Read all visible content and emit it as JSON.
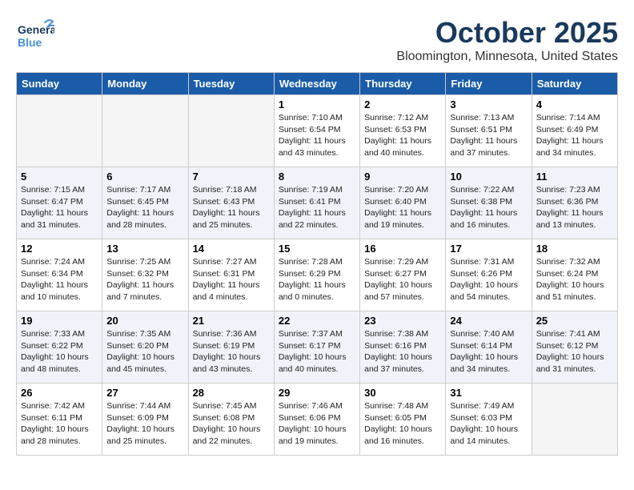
{
  "header": {
    "logo_general": "General",
    "logo_blue": "Blue",
    "month_year": "October 2025",
    "location": "Bloomington, Minnesota, United States"
  },
  "weekdays": [
    "Sunday",
    "Monday",
    "Tuesday",
    "Wednesday",
    "Thursday",
    "Friday",
    "Saturday"
  ],
  "weeks": [
    [
      {
        "day": "",
        "info": ""
      },
      {
        "day": "",
        "info": ""
      },
      {
        "day": "",
        "info": ""
      },
      {
        "day": "1",
        "info": "Sunrise: 7:10 AM\nSunset: 6:54 PM\nDaylight: 11 hours\nand 43 minutes."
      },
      {
        "day": "2",
        "info": "Sunrise: 7:12 AM\nSunset: 6:53 PM\nDaylight: 11 hours\nand 40 minutes."
      },
      {
        "day": "3",
        "info": "Sunrise: 7:13 AM\nSunset: 6:51 PM\nDaylight: 11 hours\nand 37 minutes."
      },
      {
        "day": "4",
        "info": "Sunrise: 7:14 AM\nSunset: 6:49 PM\nDaylight: 11 hours\nand 34 minutes."
      }
    ],
    [
      {
        "day": "5",
        "info": "Sunrise: 7:15 AM\nSunset: 6:47 PM\nDaylight: 11 hours\nand 31 minutes."
      },
      {
        "day": "6",
        "info": "Sunrise: 7:17 AM\nSunset: 6:45 PM\nDaylight: 11 hours\nand 28 minutes."
      },
      {
        "day": "7",
        "info": "Sunrise: 7:18 AM\nSunset: 6:43 PM\nDaylight: 11 hours\nand 25 minutes."
      },
      {
        "day": "8",
        "info": "Sunrise: 7:19 AM\nSunset: 6:41 PM\nDaylight: 11 hours\nand 22 minutes."
      },
      {
        "day": "9",
        "info": "Sunrise: 7:20 AM\nSunset: 6:40 PM\nDaylight: 11 hours\nand 19 minutes."
      },
      {
        "day": "10",
        "info": "Sunrise: 7:22 AM\nSunset: 6:38 PM\nDaylight: 11 hours\nand 16 minutes."
      },
      {
        "day": "11",
        "info": "Sunrise: 7:23 AM\nSunset: 6:36 PM\nDaylight: 11 hours\nand 13 minutes."
      }
    ],
    [
      {
        "day": "12",
        "info": "Sunrise: 7:24 AM\nSunset: 6:34 PM\nDaylight: 11 hours\nand 10 minutes."
      },
      {
        "day": "13",
        "info": "Sunrise: 7:25 AM\nSunset: 6:32 PM\nDaylight: 11 hours\nand 7 minutes."
      },
      {
        "day": "14",
        "info": "Sunrise: 7:27 AM\nSunset: 6:31 PM\nDaylight: 11 hours\nand 4 minutes."
      },
      {
        "day": "15",
        "info": "Sunrise: 7:28 AM\nSunset: 6:29 PM\nDaylight: 11 hours\nand 0 minutes."
      },
      {
        "day": "16",
        "info": "Sunrise: 7:29 AM\nSunset: 6:27 PM\nDaylight: 10 hours\nand 57 minutes."
      },
      {
        "day": "17",
        "info": "Sunrise: 7:31 AM\nSunset: 6:26 PM\nDaylight: 10 hours\nand 54 minutes."
      },
      {
        "day": "18",
        "info": "Sunrise: 7:32 AM\nSunset: 6:24 PM\nDaylight: 10 hours\nand 51 minutes."
      }
    ],
    [
      {
        "day": "19",
        "info": "Sunrise: 7:33 AM\nSunset: 6:22 PM\nDaylight: 10 hours\nand 48 minutes."
      },
      {
        "day": "20",
        "info": "Sunrise: 7:35 AM\nSunset: 6:20 PM\nDaylight: 10 hours\nand 45 minutes."
      },
      {
        "day": "21",
        "info": "Sunrise: 7:36 AM\nSunset: 6:19 PM\nDaylight: 10 hours\nand 43 minutes."
      },
      {
        "day": "22",
        "info": "Sunrise: 7:37 AM\nSunset: 6:17 PM\nDaylight: 10 hours\nand 40 minutes."
      },
      {
        "day": "23",
        "info": "Sunrise: 7:38 AM\nSunset: 6:16 PM\nDaylight: 10 hours\nand 37 minutes."
      },
      {
        "day": "24",
        "info": "Sunrise: 7:40 AM\nSunset: 6:14 PM\nDaylight: 10 hours\nand 34 minutes."
      },
      {
        "day": "25",
        "info": "Sunrise: 7:41 AM\nSunset: 6:12 PM\nDaylight: 10 hours\nand 31 minutes."
      }
    ],
    [
      {
        "day": "26",
        "info": "Sunrise: 7:42 AM\nSunset: 6:11 PM\nDaylight: 10 hours\nand 28 minutes."
      },
      {
        "day": "27",
        "info": "Sunrise: 7:44 AM\nSunset: 6:09 PM\nDaylight: 10 hours\nand 25 minutes."
      },
      {
        "day": "28",
        "info": "Sunrise: 7:45 AM\nSunset: 6:08 PM\nDaylight: 10 hours\nand 22 minutes."
      },
      {
        "day": "29",
        "info": "Sunrise: 7:46 AM\nSunset: 6:06 PM\nDaylight: 10 hours\nand 19 minutes."
      },
      {
        "day": "30",
        "info": "Sunrise: 7:48 AM\nSunset: 6:05 PM\nDaylight: 10 hours\nand 16 minutes."
      },
      {
        "day": "31",
        "info": "Sunrise: 7:49 AM\nSunset: 6:03 PM\nDaylight: 10 hours\nand 14 minutes."
      },
      {
        "day": "",
        "info": ""
      }
    ]
  ]
}
